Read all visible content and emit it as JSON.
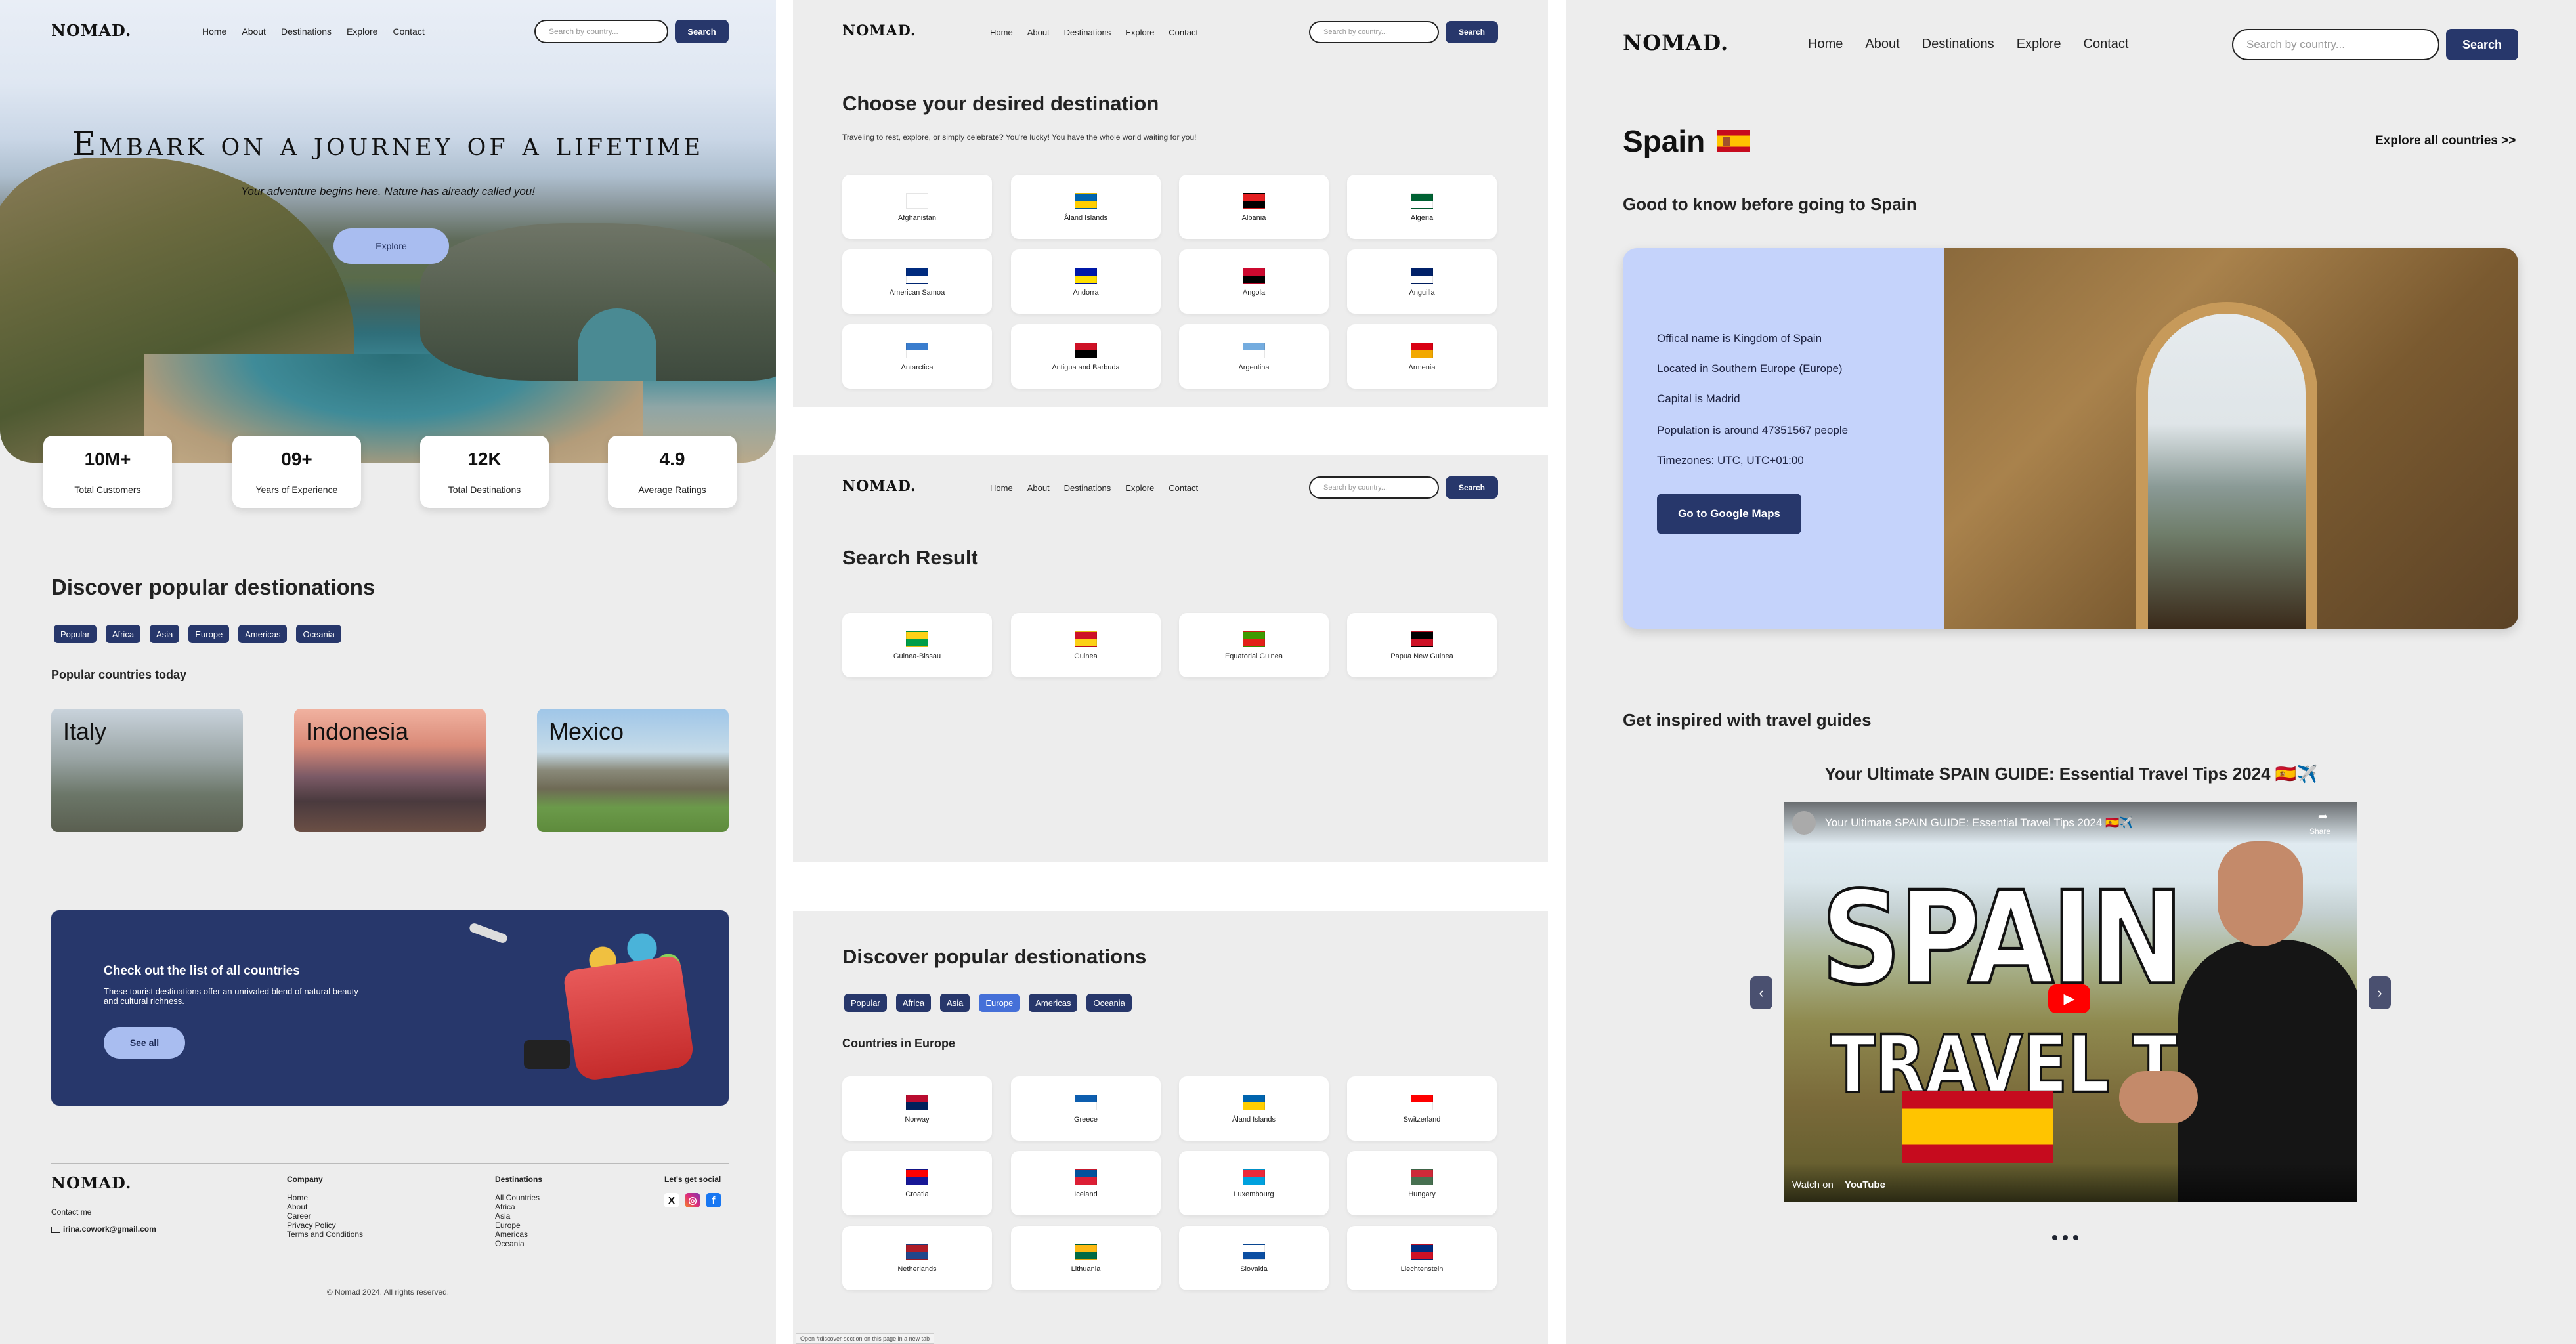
{
  "nav": {
    "logo": "NOMAD.",
    "links": [
      "Home",
      "About",
      "Destinations",
      "Explore",
      "Contact"
    ],
    "search_placeholder": "Search by country...",
    "search_button": "Search"
  },
  "home": {
    "hero_title": "Embark on a journey of a lifetime",
    "hero_subtitle": "Your adventure begins here. Nature has already called you!",
    "hero_button": "Explore",
    "stats": [
      {
        "value": "10M+",
        "label": "Total Customers"
      },
      {
        "value": "09+",
        "label": "Years of Experience"
      },
      {
        "value": "12K",
        "label": "Total Destinations"
      },
      {
        "value": "4.9",
        "label": "Average Ratings"
      }
    ],
    "discover_title": "Discover popular destionations",
    "filters": [
      "Popular",
      "Africa",
      "Asia",
      "Europe",
      "Americas",
      "Oceania"
    ],
    "popular_today": "Popular countries today",
    "popular_countries": [
      "Italy",
      "Indonesia",
      "Mexico"
    ],
    "list_card": {
      "title": "Check out the list of all countries",
      "description": "These tourist destinations offer an unrivaled blend of natural beauty and cultural richness.",
      "button": "See all"
    },
    "footer": {
      "contact_label": "Contact me",
      "email": "irina.cowork@gmail.com",
      "company_title": "Company",
      "company_links": [
        "Home",
        "About",
        "Career",
        "Privacy Policy",
        "Terms and Conditions"
      ],
      "destinations_title": "Destinations",
      "destinations_links": [
        "All Countries",
        "Africa",
        "Asia",
        "Europe",
        "Americas",
        "Oceania"
      ],
      "social_title": "Let's get social",
      "copyright": "© Nomad 2024. All rights reserved."
    }
  },
  "destinations": {
    "title": "Choose your desired destination",
    "subtitle": "Traveling to rest, explore, or simply celebrate? You're lucky! You have the whole world waiting for you!",
    "countries": [
      {
        "name": "Afghanistan",
        "colors": [
          "#ffffff",
          "#ffffff"
        ]
      },
      {
        "name": "Åland Islands",
        "colors": [
          "#0064ae",
          "#ffce00"
        ]
      },
      {
        "name": "Albania",
        "colors": [
          "#e41e20",
          "#000000"
        ]
      },
      {
        "name": "Algeria",
        "colors": [
          "#006233",
          "#ffffff"
        ]
      },
      {
        "name": "American Samoa",
        "colors": [
          "#002b7f",
          "#ffffff"
        ]
      },
      {
        "name": "Andorra",
        "colors": [
          "#0018a8",
          "#fedf00"
        ]
      },
      {
        "name": "Angola",
        "colors": [
          "#cc092f",
          "#000000"
        ]
      },
      {
        "name": "Anguilla",
        "colors": [
          "#012169",
          "#ffffff"
        ]
      },
      {
        "name": "Antarctica",
        "colors": [
          "#3a7dce",
          "#ffffff"
        ]
      },
      {
        "name": "Antigua and Barbuda",
        "colors": [
          "#ce1126",
          "#000000"
        ]
      },
      {
        "name": "Argentina",
        "colors": [
          "#74acdf",
          "#ffffff"
        ]
      },
      {
        "name": "Armenia",
        "colors": [
          "#d90012",
          "#f2a800"
        ]
      }
    ]
  },
  "search": {
    "title": "Search Result",
    "countries": [
      {
        "name": "Guinea-Bissau",
        "colors": [
          "#fcd116",
          "#009e49"
        ]
      },
      {
        "name": "Guinea",
        "colors": [
          "#ce1126",
          "#fcd116"
        ]
      },
      {
        "name": "Equatorial Guinea",
        "colors": [
          "#3e9a00",
          "#e32118"
        ]
      },
      {
        "name": "Papua New Guinea",
        "colors": [
          "#000000",
          "#ce1126"
        ]
      }
    ]
  },
  "europe": {
    "title": "Discover popular destionations",
    "filters": [
      "Popular",
      "Africa",
      "Asia",
      "Europe",
      "Americas",
      "Oceania"
    ],
    "active_filter": "Europe",
    "subtitle": "Countries in Europe",
    "countries": [
      {
        "name": "Norway",
        "colors": [
          "#ba0c2f",
          "#00205b"
        ]
      },
      {
        "name": "Greece",
        "colors": [
          "#0d5eaf",
          "#ffffff"
        ]
      },
      {
        "name": "Åland Islands",
        "colors": [
          "#0064ae",
          "#ffce00"
        ]
      },
      {
        "name": "Switzerland",
        "colors": [
          "#ff0000",
          "#ffffff"
        ]
      },
      {
        "name": "Croatia",
        "colors": [
          "#ff0000",
          "#171796"
        ]
      },
      {
        "name": "Iceland",
        "colors": [
          "#02529c",
          "#dc1e35"
        ]
      },
      {
        "name": "Luxembourg",
        "colors": [
          "#ed2939",
          "#00a1de"
        ]
      },
      {
        "name": "Hungary",
        "colors": [
          "#ce2939",
          "#477050"
        ]
      },
      {
        "name": "Netherlands",
        "colors": [
          "#ae1c28",
          "#21468b"
        ]
      },
      {
        "name": "Lithuania",
        "colors": [
          "#fdb913",
          "#006a44"
        ]
      },
      {
        "name": "Slovakia",
        "colors": [
          "#ffffff",
          "#0b4ea2"
        ]
      },
      {
        "name": "Liechtenstein",
        "colors": [
          "#002b7f",
          "#ce1126"
        ]
      }
    ],
    "status_url": "Open #discover-section on this page in a new tab"
  },
  "country": {
    "name": "Spain",
    "explore_all": "Explore all countries >>",
    "good_to_know": "Good to know before going to Spain",
    "facts": [
      "Offical name is Kingdom of Spain",
      "Located in Southern Europe (Europe)",
      "Capital is Madrid",
      "Population is around 47351567 people",
      "Timezones: UTC, UTC+01:00"
    ],
    "maps_button": "Go to Google Maps",
    "guides_title": "Get inspired with travel guides",
    "video_title": "Your Ultimate SPAIN GUIDE: Essential Travel Tips 2024 🇪🇸✈️",
    "video_embed_title": "Your Ultimate SPAIN GUIDE: Essential Travel Tips 2024 🇪🇸✈️",
    "video_share": "Share",
    "video_big_1": "SPAIN",
    "video_big_2": "TRAVEL TIPS",
    "watch_on": "Watch on",
    "youtube": "YouTube"
  },
  "colors": {
    "navy": "#27376b",
    "light_blue": "#a9bdf0",
    "active_tab": "#4570d8",
    "info_card": "#c5d3fb"
  }
}
